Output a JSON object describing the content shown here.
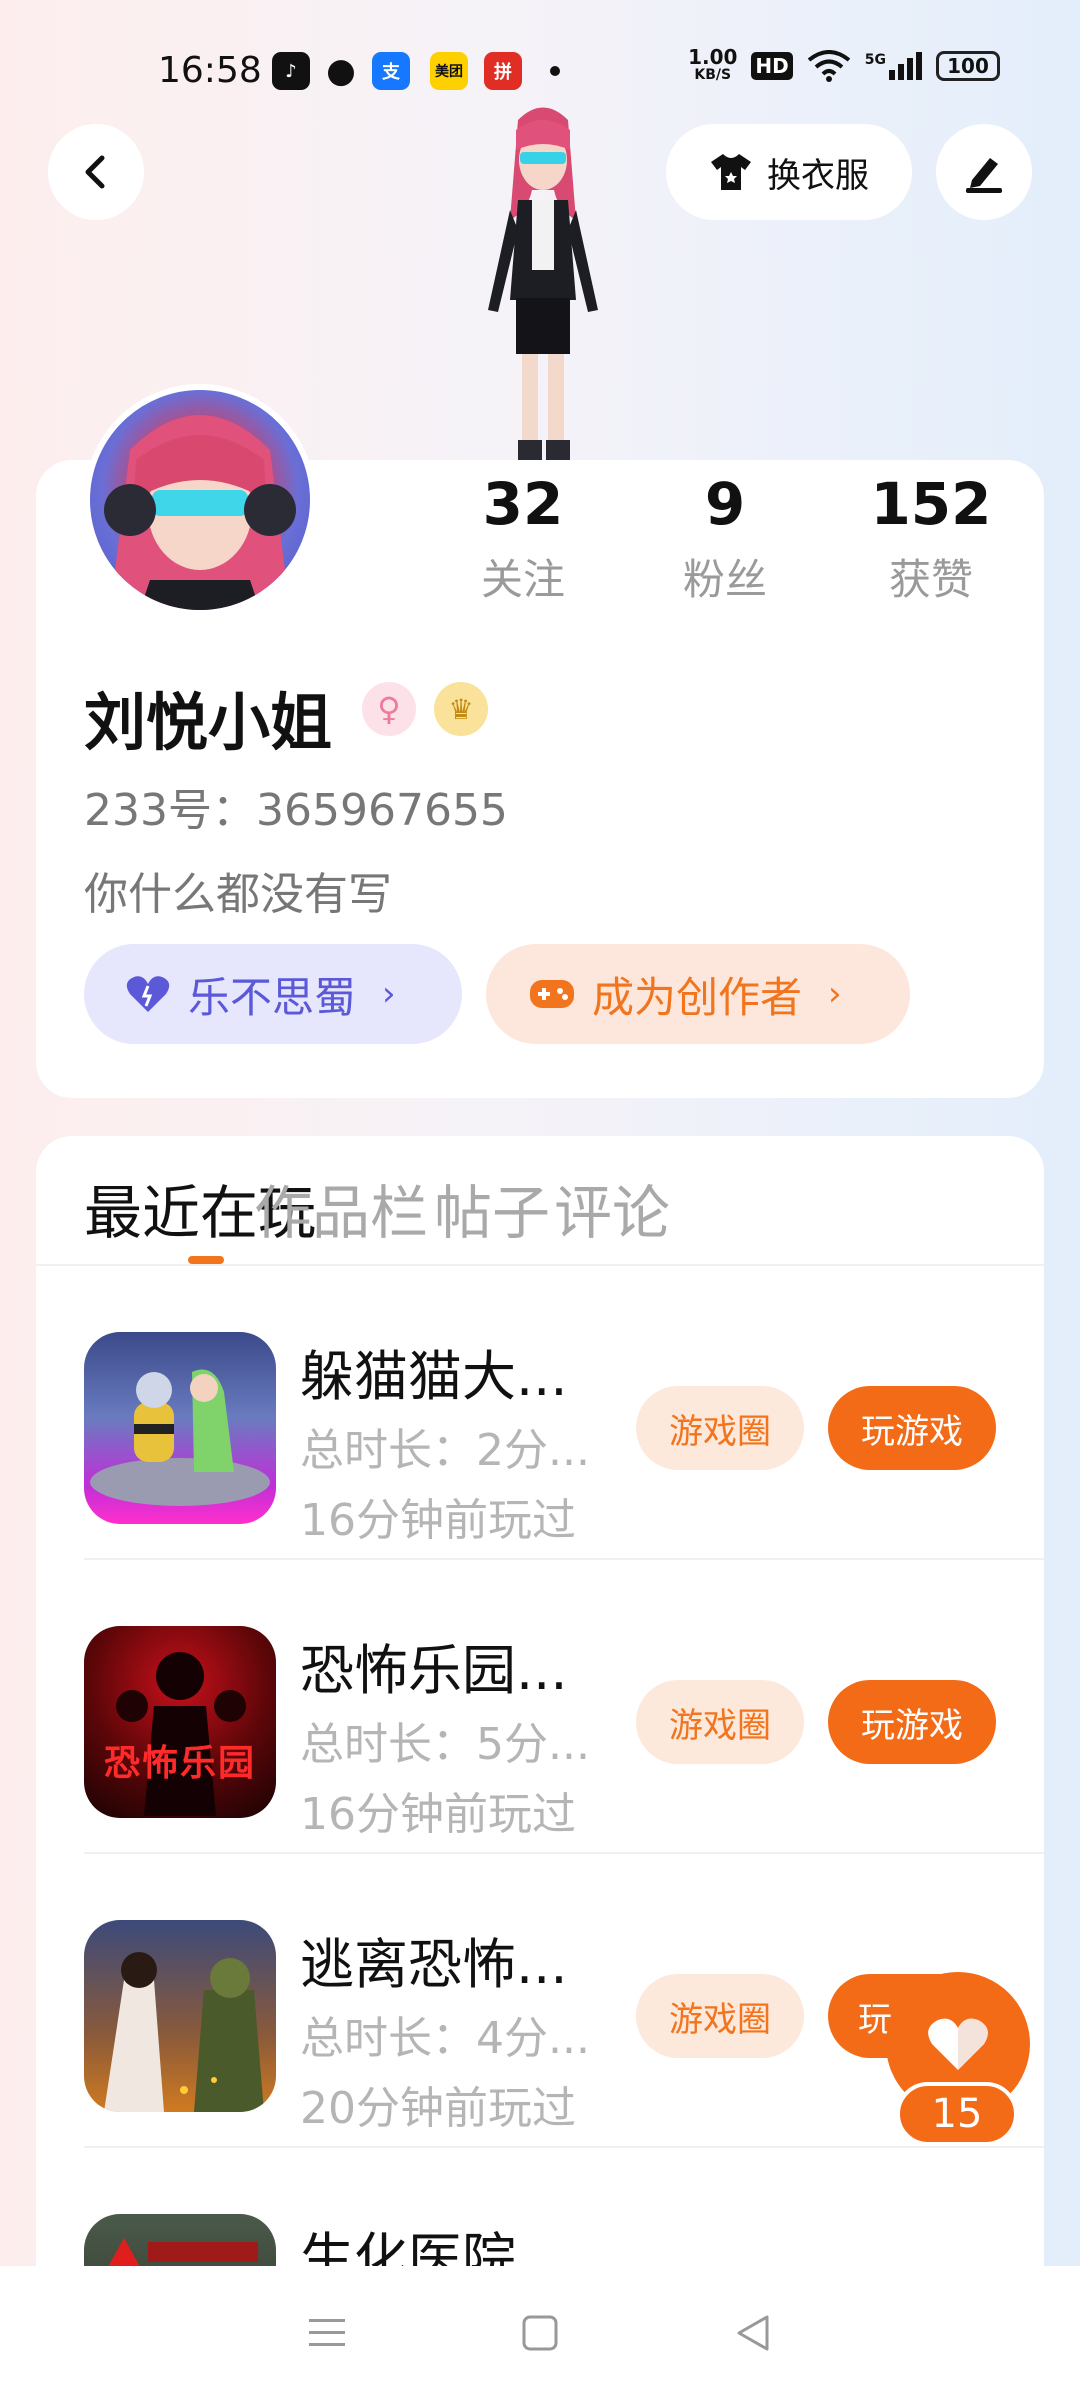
{
  "status_bar": {
    "time": "16:58",
    "apps": [
      "douyin-icon",
      "wechat-icon",
      "alipay-icon",
      "meituan-icon",
      "pinduoduo-icon"
    ],
    "speed": "1.00",
    "speed_unit": "KB/S",
    "hd": "HD",
    "net": "5G",
    "battery": "100"
  },
  "header": {
    "dress_label": "换衣服"
  },
  "profile": {
    "stats": [
      {
        "num": "32",
        "label": "关注"
      },
      {
        "num": "9",
        "label": "粉丝"
      },
      {
        "num": "152",
        "label": "获赞"
      }
    ],
    "name": "刘悦小姐",
    "uid": "233号：365967655",
    "bio": "你什么都没有写",
    "pill_left": "乐不思蜀",
    "pill_right": "成为创作者"
  },
  "tabs": [
    "最近在玩",
    "作品栏",
    "帖子",
    "评论"
  ],
  "games": [
    {
      "title": "躲猫猫大...",
      "duration": "总时长：2分...",
      "ago": "16分钟前玩过",
      "circle_btn": "游戏圈",
      "play_btn": "玩游戏"
    },
    {
      "title": "恐怖乐园...",
      "duration": "总时长：5分...",
      "ago": "16分钟前玩过",
      "circle_btn": "游戏圈",
      "play_btn": "玩游戏"
    },
    {
      "title": "逃离恐怖...",
      "duration": "总时长：4分...",
      "ago": "20分钟前玩过",
      "circle_btn": "游戏圈",
      "play_btn": "玩"
    },
    {
      "title": "生化医院...",
      "duration": "",
      "ago": "",
      "circle_btn": "",
      "play_btn": ""
    }
  ],
  "thumb_text": {
    "game2": "恐怖乐园"
  },
  "like": {
    "count": "15"
  },
  "colors": {
    "accent": "#f36b17",
    "purple": "#5b59d8"
  }
}
